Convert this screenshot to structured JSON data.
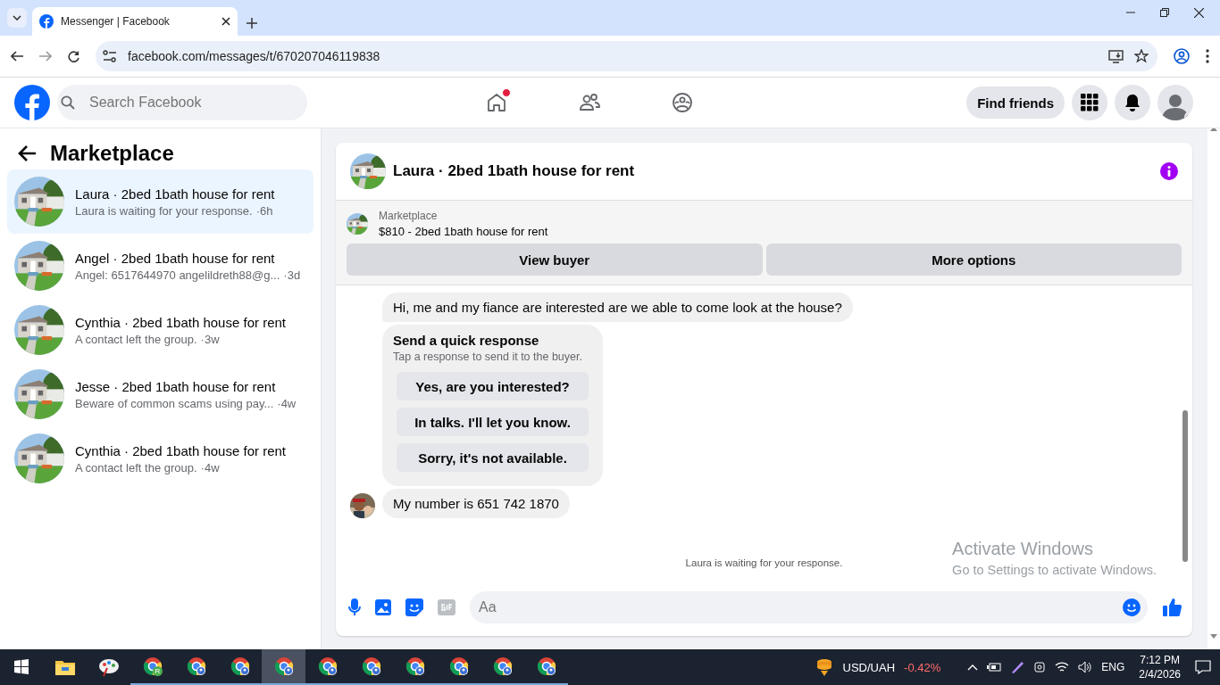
{
  "browser": {
    "tabs": [
      {
        "title": "Messenger | Facebook",
        "selected": true
      }
    ],
    "url": "facebook.com/messages/t/670207046119838"
  },
  "header": {
    "search_placeholder": "Search Facebook",
    "nav": [
      {
        "kind": "home",
        "badge": true
      },
      {
        "kind": "friends",
        "badge": false
      },
      {
        "kind": "groups",
        "badge": false
      }
    ],
    "find_friends": "Find friends"
  },
  "sidebar": {
    "title": "Marketplace",
    "conversations": [
      {
        "title": "Laura · 2bed 1bath house for rent",
        "preview": "Laura is waiting for your response.",
        "time": "·6h",
        "selected": true
      },
      {
        "title": "Angel · 2bed 1bath house for rent",
        "preview": "Angel: 6517644970 angelildreth88@g...",
        "time": "·3d",
        "selected": false
      },
      {
        "title": "Cynthia · 2bed 1bath house for rent",
        "preview": "A contact left the group.",
        "time": "·3w",
        "selected": false
      },
      {
        "title": "Jesse · 2bed 1bath house for rent",
        "preview": "Beware of common scams using pay...",
        "time": "·4w",
        "selected": false
      },
      {
        "title": "Cynthia · 2bed 1bath house for rent",
        "preview": "A contact left the group.",
        "time": "·4w",
        "selected": false
      }
    ]
  },
  "chat": {
    "title": "Laura · 2bed 1bath house for rent",
    "listing": {
      "label": "Marketplace",
      "title": "$810 - 2bed 1bath house for rent"
    },
    "buttons": [
      "View buyer",
      "More options"
    ],
    "messages": [
      {
        "kind": "text",
        "text": "Hi, me and my fiance are interested are we able to come look at the house?",
        "avatar": false
      },
      {
        "kind": "quick_response",
        "title": "Send a quick response",
        "subtitle": "Tap a response to send it to the buyer.",
        "options": [
          "Yes, are you interested?",
          "In talks. I'll let you know.",
          "Sorry, it's not available."
        ]
      },
      {
        "kind": "text",
        "text": "My number is 651 742 1870",
        "avatar": true
      }
    ],
    "status": "Laura is waiting for your response.",
    "composer_placeholder": "Aa"
  },
  "activation": {
    "title": "Activate Windows",
    "subtitle": "Go to Settings to activate Windows."
  },
  "taskbar": {
    "apps": [
      {
        "kind": "explorer",
        "selected": false
      },
      {
        "kind": "paint",
        "selected": false
      },
      {
        "kind": "chrome",
        "badge": "R",
        "selected": false
      },
      {
        "kind": "chrome",
        "selected": false
      },
      {
        "kind": "chrome",
        "selected": false
      },
      {
        "kind": "chrome",
        "selected": true
      },
      {
        "kind": "chrome",
        "selected": false
      },
      {
        "kind": "chrome",
        "selected": false
      },
      {
        "kind": "chrome",
        "selected": false
      },
      {
        "kind": "chrome",
        "selected": false
      },
      {
        "kind": "chrome",
        "selected": false
      },
      {
        "kind": "chrome",
        "selected": false
      }
    ],
    "ticker": "USD/UAH",
    "change": "-0.42%",
    "language": "ENG",
    "time": "7:12 PM",
    "date": "2/4/2026"
  }
}
